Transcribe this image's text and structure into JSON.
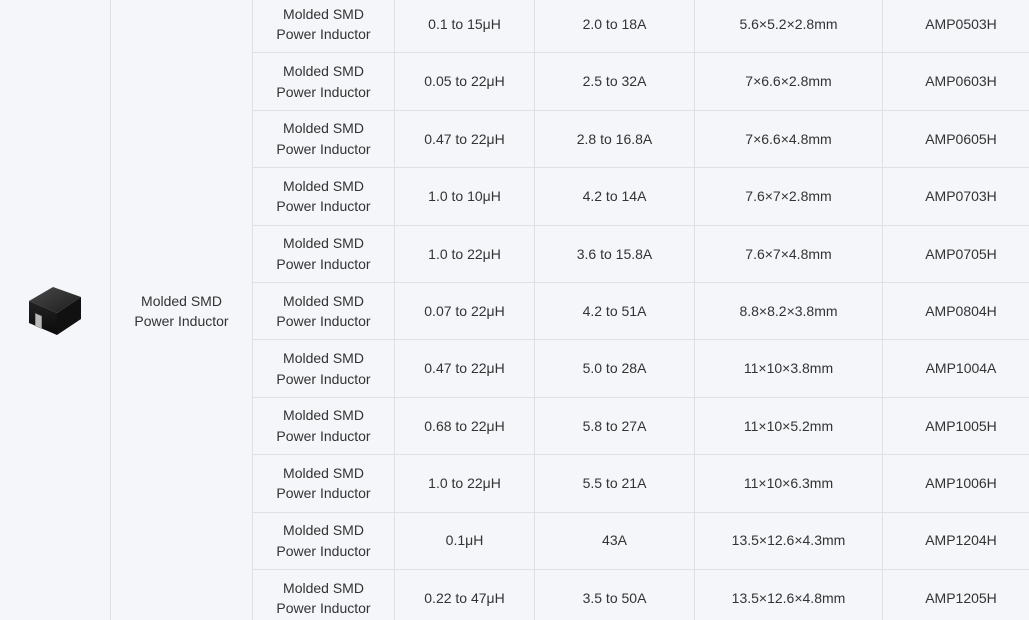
{
  "category": {
    "label_line1": "Molded SMD",
    "label_line2": "Power Inductor",
    "image_icon": "molded-smd-inductor-image"
  },
  "rows": [
    {
      "type1": "Molded SMD",
      "type2": "Power Inductor",
      "inductance": "0.1 to 15μH",
      "current": "2.0 to 18A",
      "size": "5.6×5.2×2.8mm",
      "part": "AMP0503H"
    },
    {
      "type1": "Molded SMD",
      "type2": "Power Inductor",
      "inductance": "0.05 to 22μH",
      "current": "2.5 to 32A",
      "size": "7×6.6×2.8mm",
      "part": "AMP0603H"
    },
    {
      "type1": "Molded SMD",
      "type2": "Power Inductor",
      "inductance": "0.47 to 22μH",
      "current": "2.8 to 16.8A",
      "size": "7×6.6×4.8mm",
      "part": "AMP0605H"
    },
    {
      "type1": "Molded SMD",
      "type2": "Power Inductor",
      "inductance": "1.0 to 10μH",
      "current": "4.2 to 14A",
      "size": "7.6×7×2.8mm",
      "part": "AMP0703H"
    },
    {
      "type1": "Molded SMD",
      "type2": "Power Inductor",
      "inductance": "1.0 to 22μH",
      "current": "3.6 to 15.8A",
      "size": "7.6×7×4.8mm",
      "part": "AMP0705H"
    },
    {
      "type1": "Molded SMD",
      "type2": "Power Inductor",
      "inductance": "0.07 to 22μH",
      "current": "4.2 to 51A",
      "size": "8.8×8.2×3.8mm",
      "part": "AMP0804H"
    },
    {
      "type1": "Molded SMD",
      "type2": "Power Inductor",
      "inductance": "0.47 to 22μH",
      "current": "5.0 to 28A",
      "size": "11×10×3.8mm",
      "part": "AMP1004A"
    },
    {
      "type1": "Molded SMD",
      "type2": "Power Inductor",
      "inductance": "0.68 to 22μH",
      "current": "5.8 to 27A",
      "size": "11×10×5.2mm",
      "part": "AMP1005H"
    },
    {
      "type1": "Molded SMD",
      "type2": "Power Inductor",
      "inductance": "1.0 to 22μH",
      "current": "5.5 to 21A",
      "size": "11×10×6.3mm",
      "part": "AMP1006H"
    },
    {
      "type1": "Molded SMD",
      "type2": "Power Inductor",
      "inductance": "0.1μH",
      "current": "43A",
      "size": "13.5×12.6×4.3mm",
      "part": "AMP1204H"
    },
    {
      "type1": "Molded SMD",
      "type2": "Power Inductor",
      "inductance": "0.22 to 47μH",
      "current": "3.5 to 50A",
      "size": "13.5×12.6×4.8mm",
      "part": "AMP1205H"
    }
  ],
  "colors": {
    "background": "#f4f6f9",
    "border": "#dde1e6",
    "text": "#333333"
  }
}
